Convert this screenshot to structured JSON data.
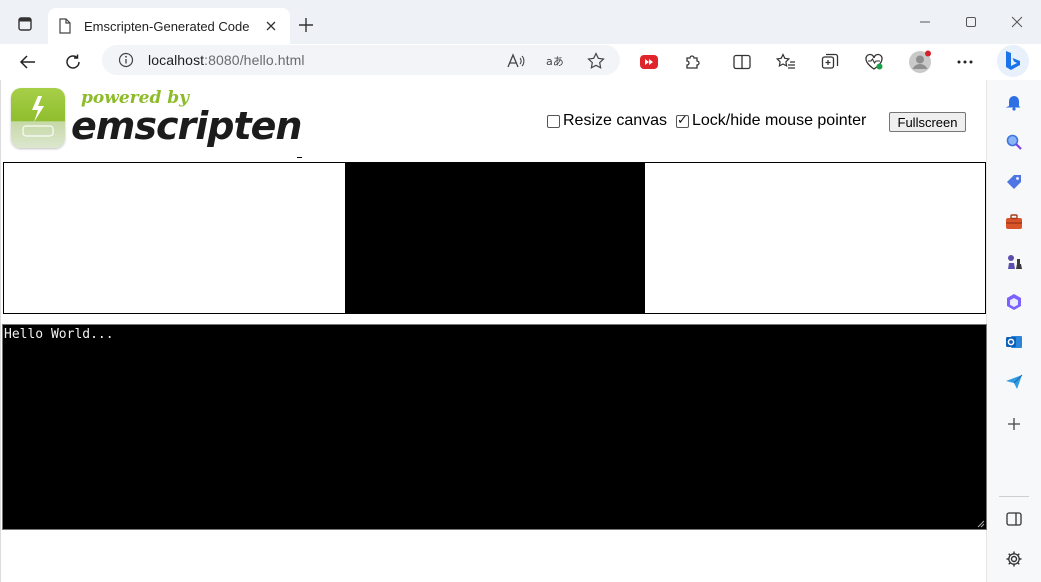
{
  "browser": {
    "tab_title": "Emscripten-Generated Code",
    "url_host": "localhost",
    "url_rest": ":8080/hello.html"
  },
  "logo": {
    "powered_by": "powered by",
    "wordmark": "emscripten"
  },
  "controls": {
    "resize_label": "Resize canvas",
    "resize_checked": false,
    "lock_label": "Lock/hide mouse pointer",
    "lock_checked": true,
    "fullscreen_label": "Fullscreen"
  },
  "output": {
    "text": "Hello World..."
  },
  "colors": {
    "accent": "#8dbb2a",
    "edge_blue": "#1a73e8",
    "canvas": "#000000"
  },
  "icons": {
    "tab_actions": "tab-actions-icon",
    "page": "page-icon",
    "close": "close-icon",
    "new_tab": "plus-icon",
    "minimize": "minimize-icon",
    "maximize": "maximize-icon",
    "window_close": "window-close-icon",
    "back": "back-arrow-icon",
    "refresh": "refresh-icon",
    "info": "info-icon",
    "read_aloud": "read-aloud-icon",
    "translate": "translate-icon",
    "favorite": "star-icon",
    "extensions": "puzzle-icon",
    "split": "split-screen-icon",
    "favorites": "favorites-list-icon",
    "collections": "collections-icon",
    "health": "browser-essentials-icon",
    "profile": "profile-icon",
    "more": "more-icon",
    "bing": "copilot-icon"
  }
}
